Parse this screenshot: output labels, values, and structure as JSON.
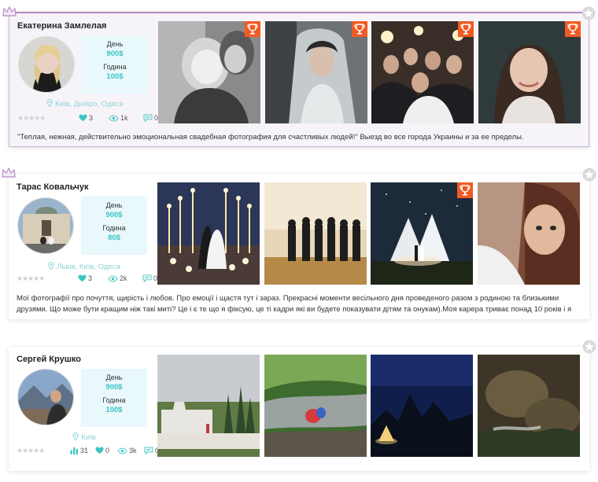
{
  "photographers": [
    {
      "name": "Екатерина Замлелая",
      "price_day_label": "День",
      "price_day": "900$",
      "price_hour_label": "Година",
      "price_hour": "100$",
      "cities": "Київ, Дніпро, Одеса",
      "likes": "3",
      "views": "1k",
      "comments": "0",
      "description": "\"Теплая, нежная, действительно эмоциональная свадебная фотография для счастливых людей!\" Выезд во все города Украины и за ее пределы."
    },
    {
      "name": "Тарас Ковальчук",
      "price_day_label": "День",
      "price_day": "900$",
      "price_hour_label": "Година",
      "price_hour": "80$",
      "cities": "Львів, Київ, Одеса",
      "likes": "3",
      "views": "2k",
      "comments": "0",
      "description": "Мої фотографії про почуття, щирість і любов. Про емоції і щастя тут і зараз. Прекрасні моменти весільного дня проведеного разом з родиною та близькими друзями. Що може бути кращим ніж такі миті? Це і є те що я фіксую, це ті кадри які ви будете показувати дітям та онукам).Моя карера триває понад 10 років і я"
    },
    {
      "name": "Сергей Крушко",
      "price_day_label": "День",
      "price_day": "900$",
      "price_hour_label": "Година",
      "price_hour": "100$",
      "cities": "Київ",
      "rating_count": "31",
      "likes": "0",
      "views": "3k",
      "comments": "0",
      "description": ""
    }
  ],
  "stars_rating": "★★★★★",
  "icons": {
    "vip": "crown-icon",
    "favorite": "star-icon",
    "award": "trophy-icon",
    "location": "pin-icon",
    "likes": "heart-icon",
    "views": "eye-icon",
    "comments": "comment-icon",
    "rating": "bar-chart-icon"
  },
  "colors": {
    "accent_teal": "#3cc4c4",
    "vip_border": "#b48bc4",
    "award_badge": "#f15a22",
    "price_box": "#e8f8fb"
  }
}
